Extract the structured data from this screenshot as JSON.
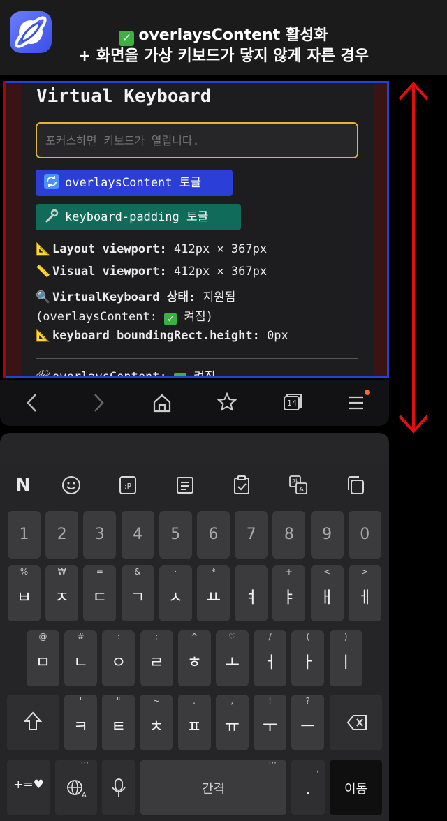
{
  "header": {
    "line1": "overlaysContent 활성화",
    "line2": "+ 화면을 가상 키보드가 닿지 않게 자른 경우",
    "check_mark": "✓"
  },
  "page": {
    "title": "Virtual Keyboard",
    "input_placeholder": "포커스하면 키보드가 열립니다.",
    "overlay_button": "overlaysContent 토글",
    "padding_button": "keyboard-padding 토글",
    "layout_label": "Layout viewport:",
    "layout_value": "412px × 367px",
    "visual_label": "Visual viewport:",
    "visual_value": "412px × 367px",
    "vk_label": "VirtualKeyboard 상태:",
    "vk_value": "지원됨",
    "vk_value2_prefix": "(overlaysContent:",
    "vk_value2_suffix": "켜짐)",
    "kb_label": "keyboard boundingRect.height:",
    "kb_value": "0px",
    "status_label": "overlaysContent:",
    "status_value": "켜짐",
    "check_mark": "✓"
  },
  "nav": {
    "icons": [
      "back-icon",
      "forward-icon",
      "home-icon",
      "bookmark-star-icon",
      "tabs-icon",
      "menu-icon"
    ],
    "tab_count": "14"
  },
  "keyboard": {
    "toolbar": [
      "naver-logo-icon",
      "emoji-icon",
      "emoticon-text-icon",
      "notes-icon",
      "clipboard-icon",
      "translate-icon",
      "copy-icon"
    ],
    "numbers": [
      "1",
      "2",
      "3",
      "4",
      "5",
      "6",
      "7",
      "8",
      "9",
      "0"
    ],
    "row1": [
      {
        "hint": "%",
        "key": "ㅂ"
      },
      {
        "hint": "₩",
        "key": "ㅈ"
      },
      {
        "hint": "=",
        "key": "ㄷ"
      },
      {
        "hint": "&",
        "key": "ㄱ"
      },
      {
        "hint": "·",
        "key": "ㅅ"
      },
      {
        "hint": "*",
        "key": "ㅛ"
      },
      {
        "hint": "-",
        "key": "ㅕ"
      },
      {
        "hint": "+",
        "key": "ㅑ"
      },
      {
        "hint": "<",
        "key": "ㅐ"
      },
      {
        "hint": ">",
        "key": "ㅔ"
      }
    ],
    "row2": [
      {
        "hint": "@",
        "key": "ㅁ"
      },
      {
        "hint": "#",
        "key": "ㄴ"
      },
      {
        "hint": ":",
        "key": "ㅇ"
      },
      {
        "hint": ";",
        "key": "ㄹ"
      },
      {
        "hint": "^",
        "key": "ㅎ"
      },
      {
        "hint": "♡",
        "key": "ㅗ"
      },
      {
        "hint": "/",
        "key": "ㅓ"
      },
      {
        "hint": "(",
        "key": "ㅏ"
      },
      {
        "hint": ")",
        "key": "ㅣ"
      }
    ],
    "row3": [
      {
        "hint": "'",
        "key": "ㅋ"
      },
      {
        "hint": "\"",
        "key": "ㅌ"
      },
      {
        "hint": "~",
        "key": "ㅊ"
      },
      {
        "hint": ".",
        "key": "ㅍ"
      },
      {
        "hint": ",",
        "key": "ㅠ"
      },
      {
        "hint": "!",
        "key": "ㅜ"
      },
      {
        "hint": "?",
        "key": "ㅡ"
      }
    ],
    "symbols_key": "+=♥",
    "space_key": "간격",
    "period_key": ".",
    "period_hint": ",",
    "enter_key": "이동",
    "more_dots": "···"
  },
  "colors": {
    "viewport_border": "#2342d8",
    "arrow": "#e01010",
    "focus_border": "#e2b23c",
    "overlay_button": "#2b3fd6",
    "padding_button": "#116b5a"
  }
}
